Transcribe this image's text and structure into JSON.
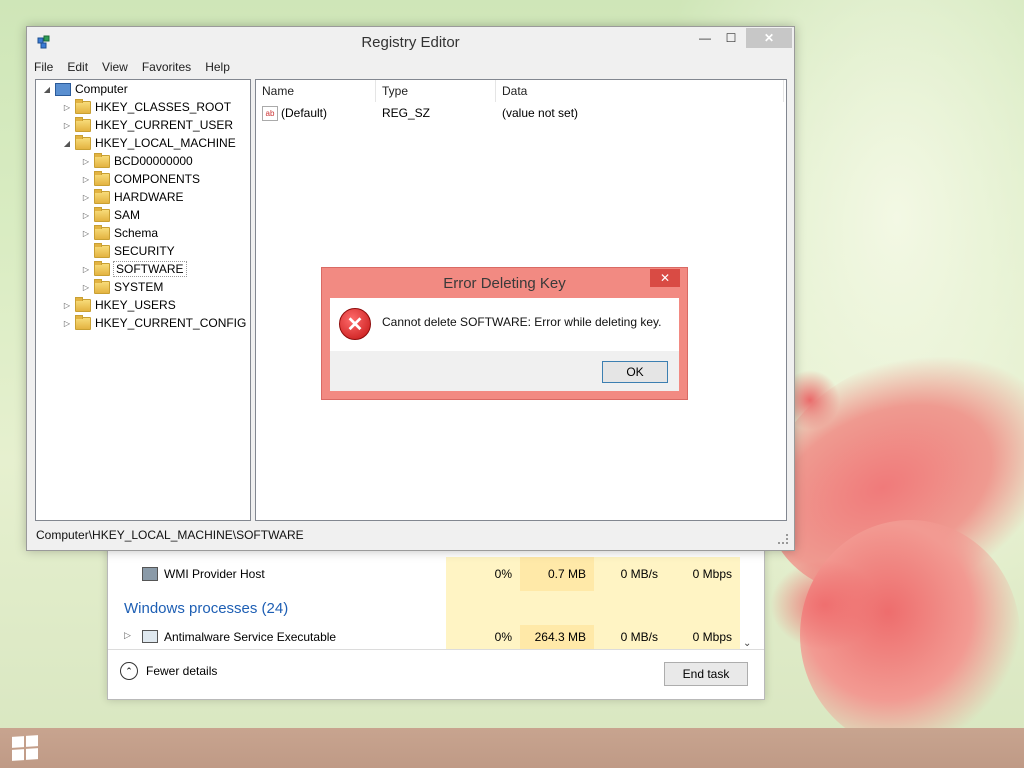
{
  "registry_editor": {
    "title": "Registry Editor",
    "menu": [
      "File",
      "Edit",
      "View",
      "Favorites",
      "Help"
    ],
    "window_buttons": {
      "minimize": "—",
      "maximize": "☐",
      "close": "✕"
    },
    "tree": {
      "root": "Computer",
      "hives": [
        {
          "label": "HKEY_CLASSES_ROOT",
          "expander": "▷"
        },
        {
          "label": "HKEY_CURRENT_USER",
          "expander": "▷"
        },
        {
          "label": "HKEY_LOCAL_MACHINE",
          "expander": "◢"
        },
        {
          "label": "HKEY_USERS",
          "expander": "▷"
        },
        {
          "label": "HKEY_CURRENT_CONFIG",
          "expander": "▷"
        }
      ],
      "hklm_children": [
        {
          "label": "BCD00000000",
          "expander": "▷"
        },
        {
          "label": "COMPONENTS",
          "expander": "▷"
        },
        {
          "label": "HARDWARE",
          "expander": "▷"
        },
        {
          "label": "SAM",
          "expander": "▷"
        },
        {
          "label": "Schema",
          "expander": "▷"
        },
        {
          "label": "SECURITY",
          "expander": ""
        },
        {
          "label": "SOFTWARE",
          "expander": "▷"
        },
        {
          "label": "SYSTEM",
          "expander": "▷"
        }
      ],
      "selected": "SOFTWARE"
    },
    "columns": [
      "Name",
      "Type",
      "Data"
    ],
    "values": [
      {
        "name": "(Default)",
        "type": "REG_SZ",
        "data": "(value not set)",
        "icon_text": "ab"
      }
    ],
    "status_path": "Computer\\HKEY_LOCAL_MACHINE\\SOFTWARE"
  },
  "error_dialog": {
    "title": "Error Deleting Key",
    "message": "Cannot delete SOFTWARE:  Error while deleting key.",
    "ok_label": "OK",
    "close": "✕",
    "icon_glyph": "✕"
  },
  "task_manager": {
    "rows": [
      {
        "name": "WMI Provider Host",
        "cpu": "0%",
        "memory": "0.7 MB",
        "disk": "0 MB/s",
        "network": "0 Mbps"
      }
    ],
    "group_label": "Windows processes (24)",
    "group_rows": [
      {
        "name": "Antimalware Service Executable",
        "cpu": "0%",
        "memory": "264.3 MB",
        "disk": "0 MB/s",
        "network": "0 Mbps"
      }
    ],
    "fewer_details_label": "Fewer details",
    "end_task_label": "End task"
  }
}
